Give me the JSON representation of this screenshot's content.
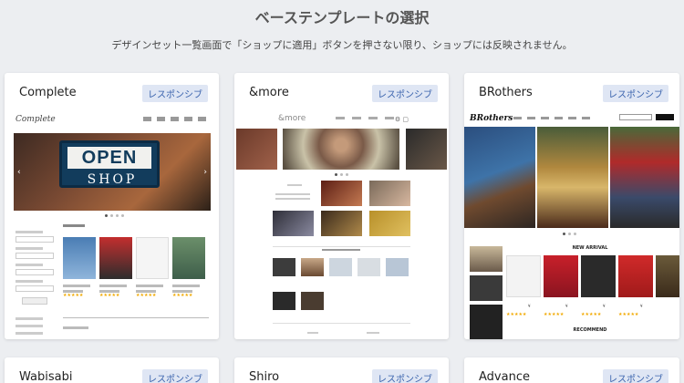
{
  "header": {
    "title": "ベーステンプレートの選択",
    "subtitle": "デザインセット一覧画面で「ショップに適用」ボタンを押さない限り、ショップには反映されません。"
  },
  "templates": [
    {
      "name": "Complete",
      "badge": "レスポンシブ"
    },
    {
      "name": "&more",
      "badge": "レスポンシブ"
    },
    {
      "name": "BRothers",
      "badge": "レスポンシブ"
    },
    {
      "name": "Wabisabi",
      "badge": "レスポンシブ"
    },
    {
      "name": "Shiro",
      "badge": "レスポンシブ"
    },
    {
      "name": "Advance",
      "badge": "レスポンシブ"
    }
  ],
  "previews": {
    "complete": {
      "logo": "Complete",
      "hero_top": "OPEN",
      "hero_bottom": "SHOP"
    },
    "andmore": {
      "logo": "&more"
    },
    "brothers": {
      "logo": "BRothers",
      "new_arrival": "NEW ARRIVAL",
      "recommend": "RECOMMEND"
    }
  },
  "colors": {
    "background": "#eceef1",
    "badge_bg": "#dfe6f4",
    "badge_text": "#3a63ad"
  }
}
